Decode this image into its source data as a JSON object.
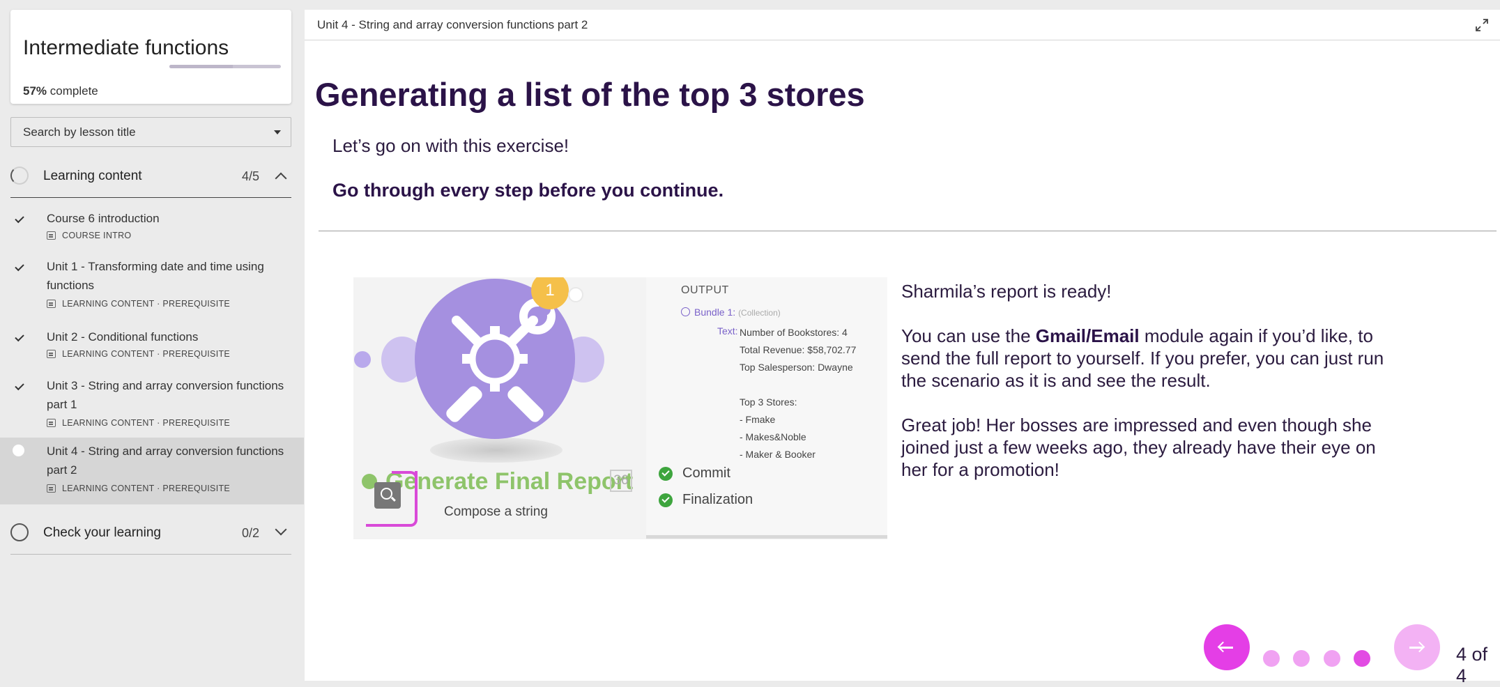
{
  "sidebar": {
    "course_title": "Intermediate functions",
    "progress_percent": 57,
    "progress_label": "57%",
    "progress_suffix": "complete",
    "search_placeholder": "Search by lesson title",
    "sections": [
      {
        "title": "Learning content",
        "count": "4/5",
        "expanded": true,
        "lessons": [
          {
            "title": "Course 6 introduction",
            "meta": "COURSE INTRO",
            "completed": true
          },
          {
            "title": "Unit 1 - Transforming date and time using functions",
            "meta": "LEARNING CONTENT · PREREQUISITE",
            "completed": true
          },
          {
            "title": "Unit 2 - Conditional functions",
            "meta": "LEARNING CONTENT · PREREQUISITE",
            "completed": true
          },
          {
            "title": "Unit 3 - String and array conversion functions part 1",
            "meta": "LEARNING CONTENT · PREREQUISITE",
            "completed": true
          },
          {
            "title": "Unit 4 - String and array conversion functions part 2",
            "meta": "LEARNING CONTENT · PREREQUISITE",
            "completed": false,
            "active": true
          }
        ]
      },
      {
        "title": "Check your learning",
        "count": "0/2",
        "expanded": false
      }
    ]
  },
  "main": {
    "unit_title": "Unit 4 - String and array conversion functions part 2",
    "heading": "Generating a list of the top 3 stores",
    "intro_1": "Let’s go on with this exercise!",
    "intro_2": "Go through every step before you continue.",
    "figure": {
      "badge": "1",
      "module_title": "Generate Final Report",
      "module_number": "36",
      "module_subtitle": "Compose a string",
      "output_title": "OUTPUT",
      "bundle_label": "Bundle 1:",
      "bundle_type": "(Collection)",
      "text_label": "Text:",
      "text_lines": "Number of Bookstores: 4\nTotal Revenue: $58,702.77\nTop Salesperson: Dwayne\n\nTop 3 Stores:\n- Fmake\n- Makes&Noble\n- Maker & Booker",
      "stages": [
        "Commit",
        "Finalization"
      ]
    },
    "paragraph_1": "Sharmila’s report is ready!",
    "paragraph_2_pre": "You can use the ",
    "paragraph_2_bold_1": "Gmail",
    "paragraph_2_sep": "/",
    "paragraph_2_bold_2": "Email",
    "paragraph_2_post": " module again if you’d like, to send the full report to yourself. If you prefer, you can just run the scenario as it is and see the result.",
    "paragraph_3": "Great job! Her bosses are impressed and even though she joined just a few weeks ago, they already have their eye on her for a promotion!",
    "pagination": {
      "current": 4,
      "total": 4,
      "label": "4 of 4"
    }
  },
  "icons": {
    "expand": "expand-icon",
    "zoom": "zoom-in-icon",
    "prev": "arrow-left-icon",
    "next": "arrow-right-icon"
  },
  "colors": {
    "accent": "#e43ee6",
    "accent_light": "#f3b2f4",
    "heading": "#2b1348",
    "module_purple": "#a590e0",
    "module_green": "#8ec46a"
  }
}
